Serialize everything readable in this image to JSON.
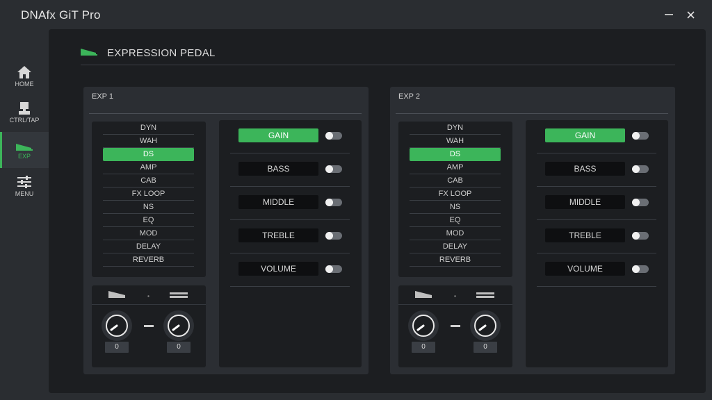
{
  "app": {
    "title": "DNAfx GiT Pro"
  },
  "window": {
    "minimize_icon": "minimize-icon",
    "close_icon": "close-icon"
  },
  "sidebar": {
    "items": [
      {
        "label": "HOME",
        "icon": "home-icon",
        "active": false
      },
      {
        "label": "CTRL/TAP",
        "icon": "footswitch-icon",
        "active": false
      },
      {
        "label": "EXP",
        "icon": "expression-pedal-icon",
        "active": true
      },
      {
        "label": "MENU",
        "icon": "sliders-icon",
        "active": false
      }
    ]
  },
  "page": {
    "title": "EXPRESSION PEDAL",
    "icon": "expression-pedal-icon"
  },
  "colors": {
    "accent": "#3cb55a",
    "background": "#2a2d31",
    "panel": "#1c1e21"
  },
  "exp_panels": [
    {
      "title": "EXP 1",
      "fx_items": [
        "DYN",
        "WAH",
        "DS",
        "AMP",
        "CAB",
        "FX LOOP",
        "NS",
        "EQ",
        "MOD",
        "DELAY",
        "REVERB"
      ],
      "selected_fx": "DS",
      "heel": {
        "value": "0"
      },
      "toe": {
        "value": "0"
      },
      "params": [
        {
          "label": "GAIN",
          "selected": true,
          "enabled": false
        },
        {
          "label": "BASS",
          "selected": false,
          "enabled": false
        },
        {
          "label": "MIDDLE",
          "selected": false,
          "enabled": false
        },
        {
          "label": "TREBLE",
          "selected": false,
          "enabled": false
        },
        {
          "label": "VOLUME",
          "selected": false,
          "enabled": false
        }
      ]
    },
    {
      "title": "EXP 2",
      "fx_items": [
        "DYN",
        "WAH",
        "DS",
        "AMP",
        "CAB",
        "FX LOOP",
        "NS",
        "EQ",
        "MOD",
        "DELAY",
        "REVERB"
      ],
      "selected_fx": "DS",
      "heel": {
        "value": "0"
      },
      "toe": {
        "value": "0"
      },
      "params": [
        {
          "label": "GAIN",
          "selected": true,
          "enabled": false
        },
        {
          "label": "BASS",
          "selected": false,
          "enabled": false
        },
        {
          "label": "MIDDLE",
          "selected": false,
          "enabled": false
        },
        {
          "label": "TREBLE",
          "selected": false,
          "enabled": false
        },
        {
          "label": "VOLUME",
          "selected": false,
          "enabled": false
        }
      ]
    }
  ]
}
